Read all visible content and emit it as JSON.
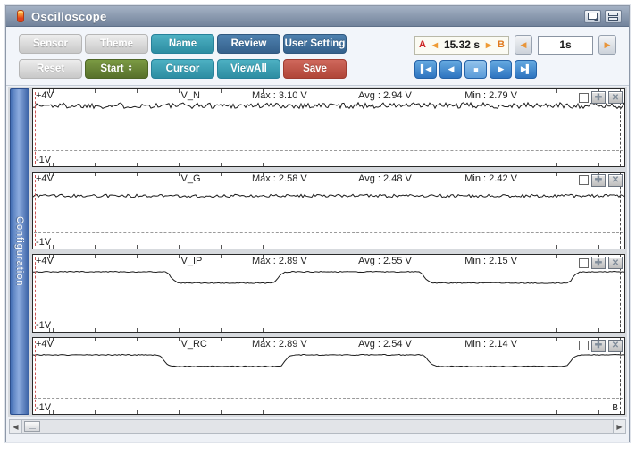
{
  "window": {
    "title": "Oscilloscope"
  },
  "toolbar": {
    "buttons": [
      {
        "label": "Sensor",
        "variant": "silver",
        "row": 0
      },
      {
        "label": "Theme",
        "variant": "silver",
        "row": 0
      },
      {
        "label": "Name",
        "variant": "teal",
        "row": 0
      },
      {
        "label": "Review",
        "variant": "steel",
        "row": 0
      },
      {
        "label": "User Setting",
        "variant": "steel",
        "row": 0
      },
      {
        "label": "Reset",
        "variant": "silver",
        "row": 1
      },
      {
        "label": "Start",
        "variant": "green",
        "row": 1,
        "spinner": true
      },
      {
        "label": "Cursor",
        "variant": "teal",
        "row": 1
      },
      {
        "label": "ViewAll",
        "variant": "teal",
        "row": 1
      },
      {
        "label": "Save",
        "variant": "red",
        "row": 1
      }
    ]
  },
  "transport": {
    "cursor_a": "A",
    "cursor_b": "B",
    "left_arrow": "◀",
    "right_arrow": "▶",
    "ab_time": "15.32 s",
    "interval": "1s",
    "playback": [
      {
        "name": "skip-start-button",
        "glyph": "▌◀",
        "active": false
      },
      {
        "name": "step-back-button",
        "glyph": "◀",
        "active": false
      },
      {
        "name": "stop-button",
        "glyph": "■",
        "active": true
      },
      {
        "name": "play-button",
        "glyph": "▶",
        "active": false
      },
      {
        "name": "skip-end-button",
        "glyph": "▶▌",
        "active": false
      }
    ]
  },
  "sidebar": {
    "tab_label": "Configuration"
  },
  "stats_labels": {
    "max": "Max :",
    "avg": "Avg :",
    "min": "Min :"
  },
  "controls": {
    "plus_glyph": "✚",
    "close_glyph": "✕"
  },
  "cursor_b_label": "B",
  "channels": [
    {
      "name": "V_N",
      "scale_top": "+4V",
      "scale_bottom": "-1V",
      "max": "3.10 V",
      "avg": "2.94 V",
      "min": "2.79 V"
    },
    {
      "name": "V_G",
      "scale_top": "+4V",
      "scale_bottom": "-1V",
      "max": "2.58 V",
      "avg": "2.48 V",
      "min": "2.42 V"
    },
    {
      "name": "V_IP",
      "scale_top": "+4V",
      "scale_bottom": "-1V",
      "max": "2.89 V",
      "avg": "2.55 V",
      "min": "2.15 V"
    },
    {
      "name": "V_RC",
      "scale_top": "+4V",
      "scale_bottom": "-1V",
      "max": "2.89 V",
      "avg": "2.54 V",
      "min": "2.14 V"
    }
  ],
  "chart_data": [
    {
      "type": "line",
      "title": "V_N",
      "ylim": [
        -1,
        4
      ],
      "y_top_label": "+4V",
      "y_bottom_label": "-1V",
      "unit": "V",
      "x_span_between_cursors_s": 15.32,
      "stats": {
        "max": 3.1,
        "avg": 2.94,
        "min": 2.79
      },
      "waveform": {
        "shape": "noisy-flat",
        "level": 2.94,
        "high": 3.1,
        "low": 2.79
      }
    },
    {
      "type": "line",
      "title": "V_G",
      "ylim": [
        -1,
        4
      ],
      "y_top_label": "+4V",
      "y_bottom_label": "-1V",
      "unit": "V",
      "x_span_between_cursors_s": 15.32,
      "stats": {
        "max": 2.58,
        "avg": 2.48,
        "min": 2.42
      },
      "waveform": {
        "shape": "noisy-flat",
        "level": 2.48,
        "high": 2.58,
        "low": 2.42
      }
    },
    {
      "type": "line",
      "title": "V_IP",
      "ylim": [
        -1,
        4
      ],
      "y_top_label": "+4V",
      "y_bottom_label": "-1V",
      "unit": "V",
      "x_span_between_cursors_s": 15.32,
      "stats": {
        "max": 2.89,
        "avg": 2.55,
        "min": 2.15
      },
      "waveform": {
        "shape": "square",
        "high": 2.89,
        "low": 2.15,
        "start": "high",
        "edge_fractions": [
          0.233,
          0.415,
          0.663,
          0.915
        ]
      }
    },
    {
      "type": "line",
      "title": "V_RC",
      "ylim": [
        -1,
        4
      ],
      "y_top_label": "+4V",
      "y_bottom_label": "-1V",
      "unit": "V",
      "x_span_between_cursors_s": 15.32,
      "stats": {
        "max": 2.89,
        "avg": 2.54,
        "min": 2.14
      },
      "waveform": {
        "shape": "square",
        "high": 2.89,
        "low": 2.14,
        "start": "high",
        "edge_fractions": [
          0.222,
          0.426,
          0.668,
          0.911
        ]
      }
    }
  ]
}
